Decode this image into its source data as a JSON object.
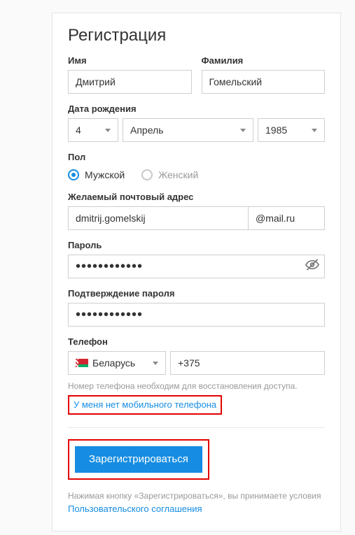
{
  "title": "Регистрация",
  "name": {
    "first_label": "Имя",
    "first_value": "Дмитрий",
    "last_label": "Фамилия",
    "last_value": "Гомельский"
  },
  "dob": {
    "label": "Дата рождения",
    "day": "4",
    "month": "Апрель",
    "year": "1985"
  },
  "gender": {
    "label": "Пол",
    "male": "Мужской",
    "female": "Женский",
    "selected": "male"
  },
  "email": {
    "label": "Желаемый почтовый адрес",
    "local": "dmitrij.gomelskij",
    "domain": "@mail.ru"
  },
  "password": {
    "label": "Пароль",
    "value": "••••••••••••",
    "confirm_label": "Подтверждение пароля",
    "confirm_value": "••••••••••••"
  },
  "phone": {
    "label": "Телефон",
    "country": "Беларусь",
    "code": "+375",
    "hint": "Номер телефона необходим для восстановления доступа.",
    "no_phone_link": "У меня нет мобильного телефона"
  },
  "submit": {
    "label": "Зарегистрироваться"
  },
  "terms": {
    "prefix": "Нажимая кнопку «Зарегистрироваться», вы принимаете условия ",
    "link": "Пользовательского соглашения"
  }
}
